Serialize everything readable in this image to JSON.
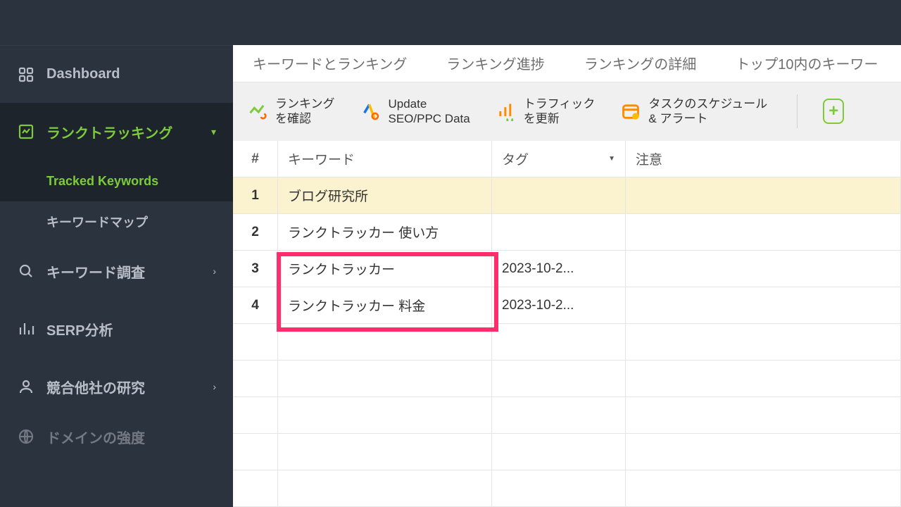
{
  "sidebar": {
    "dashboard": "Dashboard",
    "rank_tracking": "ランクトラッキング",
    "tracked_keywords": "Tracked Keywords",
    "keyword_map": "キーワードマップ",
    "keyword_research": "キーワード調査",
    "serp": "SERP分析",
    "competitor": "競合他社の研究",
    "domain": "ドメインの強度"
  },
  "tabs": {
    "t1": "キーワードとランキング",
    "t2": "ランキング進捗",
    "t3": "ランキングの詳細",
    "t4": "トップ10内のキーワー"
  },
  "toolbar": {
    "check_rank1": "ランキング",
    "check_rank2": "を確認",
    "update1": "Update",
    "update2": "SEO/PPC Data",
    "traffic1": "トラフィック",
    "traffic2": "を更新",
    "task1": "タスクのスケジュール",
    "task2": "& アラート",
    "add": "+"
  },
  "columns": {
    "num": "#",
    "kw": "キーワード",
    "tag": "タグ",
    "note": "注意"
  },
  "rows": [
    {
      "n": "1",
      "kw": "ブログ研究所",
      "tag": "",
      "note": ""
    },
    {
      "n": "2",
      "kw": "ランクトラッカー 使い方",
      "tag": "",
      "note": ""
    },
    {
      "n": "3",
      "kw": "ランクトラッカー",
      "tag": "2023-10-2...",
      "note": ""
    },
    {
      "n": "4",
      "kw": "ランクトラッカー 料金",
      "tag": "2023-10-2...",
      "note": ""
    }
  ]
}
